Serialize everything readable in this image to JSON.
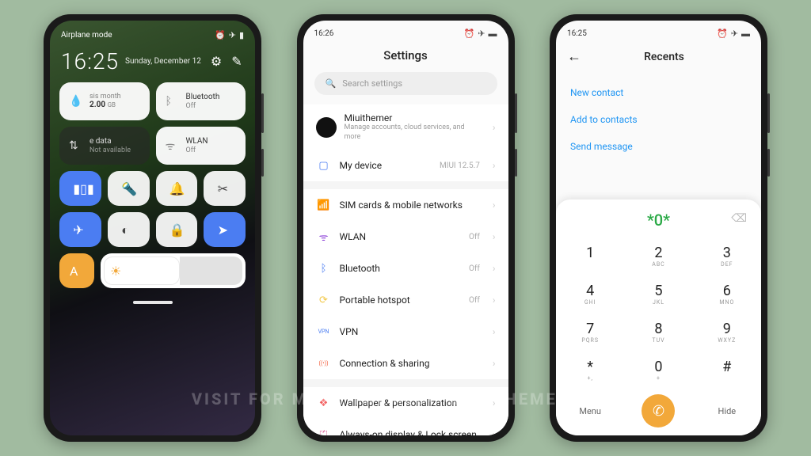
{
  "watermark": "VISIT FOR MORE THEMES - MIUITHEMER.COM",
  "phone1": {
    "status_left": "Airplane mode",
    "time": "16:25",
    "date": "Sunday, December 12",
    "data_tile": {
      "label": "sis month",
      "value": "2.00",
      "unit": "GB"
    },
    "bt_tile": {
      "label": "Bluetooth",
      "sub": "Off"
    },
    "mobile_tile": {
      "label": "e data",
      "sub": "Not available"
    },
    "wlan_tile": {
      "label": "WLAN",
      "sub": "Off"
    }
  },
  "phone2": {
    "status_time": "16:26",
    "title": "Settings",
    "search_placeholder": "Search settings",
    "account": {
      "name": "Miuithemer",
      "sub": "Manage accounts, cloud services, and more"
    },
    "device": {
      "label": "My device",
      "trail": "MIUI 12.5.7"
    },
    "items": [
      {
        "icon": "📶",
        "color": "#f2a83a",
        "label": "SIM cards & mobile networks",
        "trail": ""
      },
      {
        "icon": "ᯤ",
        "color": "#8e44d8",
        "label": "WLAN",
        "trail": "Off"
      },
      {
        "icon": "ᛒ",
        "color": "#4b7df2",
        "label": "Bluetooth",
        "trail": "Off"
      },
      {
        "icon": "⟳",
        "color": "#f2c94c",
        "label": "Portable hotspot",
        "trail": "Off"
      },
      {
        "icon": "VPN",
        "color": "#4b7df2",
        "label": "VPN",
        "trail": ""
      },
      {
        "icon": "((•))",
        "color": "#f25c3a",
        "label": "Connection & sharing",
        "trail": ""
      }
    ],
    "items2": [
      {
        "icon": "❖",
        "color": "#f25c5c",
        "label": "Wallpaper & personalization"
      },
      {
        "icon": "⏍",
        "color": "#d64d8a",
        "label": "Always-on display & Lock screen"
      }
    ]
  },
  "phone3": {
    "status_time": "16:25",
    "title": "Recents",
    "links": [
      "New contact",
      "Add to contacts",
      "Send message"
    ],
    "number": "*0*",
    "keys": [
      {
        "m": "1",
        "s": ""
      },
      {
        "m": "2",
        "s": "ABC"
      },
      {
        "m": "3",
        "s": "DEF"
      },
      {
        "m": "4",
        "s": "GHI"
      },
      {
        "m": "5",
        "s": "JKL"
      },
      {
        "m": "6",
        "s": "MNO"
      },
      {
        "m": "7",
        "s": "PQRS"
      },
      {
        "m": "8",
        "s": "TUV"
      },
      {
        "m": "9",
        "s": "WXYZ"
      },
      {
        "m": "*",
        "s": "+,"
      },
      {
        "m": "0",
        "s": "+"
      },
      {
        "m": "#",
        "s": ""
      }
    ],
    "menu": "Menu",
    "hide": "Hide"
  }
}
